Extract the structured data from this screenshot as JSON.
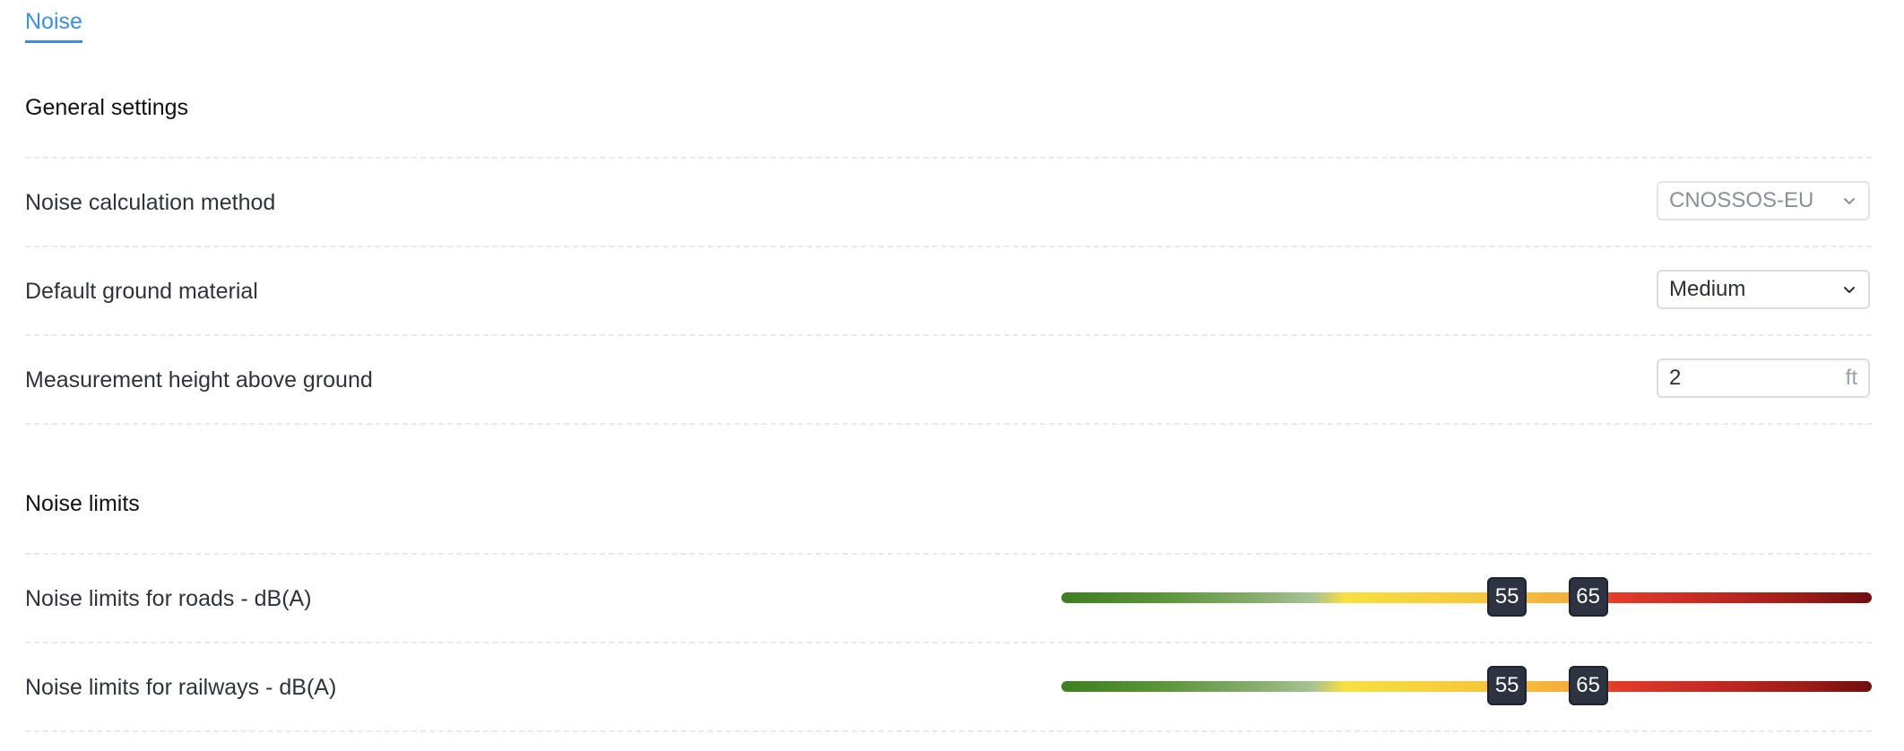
{
  "tabs": [
    {
      "label": "Noise"
    }
  ],
  "sections": {
    "general": {
      "title": "General settings"
    },
    "limits": {
      "title": "Noise limits"
    }
  },
  "settings": {
    "calc_method": {
      "label": "Noise calculation method",
      "value": "CNOSSOS-EU",
      "disabled": true
    },
    "ground_material": {
      "label": "Default ground material",
      "value": "Medium"
    },
    "measurement_height": {
      "label": "Measurement height above ground",
      "value": "2",
      "unit": "ft"
    }
  },
  "limits": {
    "range": [
      0,
      100
    ],
    "roads": {
      "label": "Noise limits for roads - dB(A)",
      "low": 55,
      "high": 65,
      "low_label": "55",
      "high_label": "65"
    },
    "railways": {
      "label": "Noise limits for railways - dB(A)",
      "low": 55,
      "high": 65,
      "low_label": "55",
      "high_label": "65"
    }
  },
  "colors": {
    "accent": "#3d8fd9",
    "handle": "#2d3340",
    "green": "#3e7e22",
    "yellow": "#f7e03f",
    "red": "#e33c2b"
  },
  "icons": {
    "dropdown": "chevron-down-icon"
  }
}
